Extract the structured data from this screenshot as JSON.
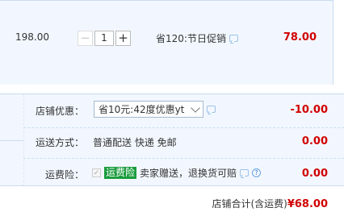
{
  "item": {
    "unit_price": "198.00",
    "quantity": "1",
    "minus": "−",
    "plus": "+",
    "promo": "省120:节日促销",
    "total": "78.00"
  },
  "shop": {
    "discount_label": "店铺优惠：",
    "discount_selected": "省10元:42度优惠yt",
    "discount_value": "-10.00",
    "shipping_label": "运送方式：",
    "shipping_value_text": "普通配送 快递 免邮",
    "shipping_value": "0.00",
    "insurance_label": "运费险：",
    "insurance_tag": "运费险",
    "insurance_text": "卖家赠送，退换货可赔",
    "insurance_help": "?",
    "insurance_value": "0.00"
  },
  "footer": {
    "label": "店铺合计(含运费)",
    "amount": "¥68.00"
  },
  "icons": {
    "chat": "chat-bubble-icon",
    "help": "question-circle-icon",
    "check": "checkbox-checked-icon"
  },
  "colors": {
    "price_red": "#d10000",
    "panel_bg": "#f2f7ff",
    "insurance_green": "#1b9c3e"
  }
}
